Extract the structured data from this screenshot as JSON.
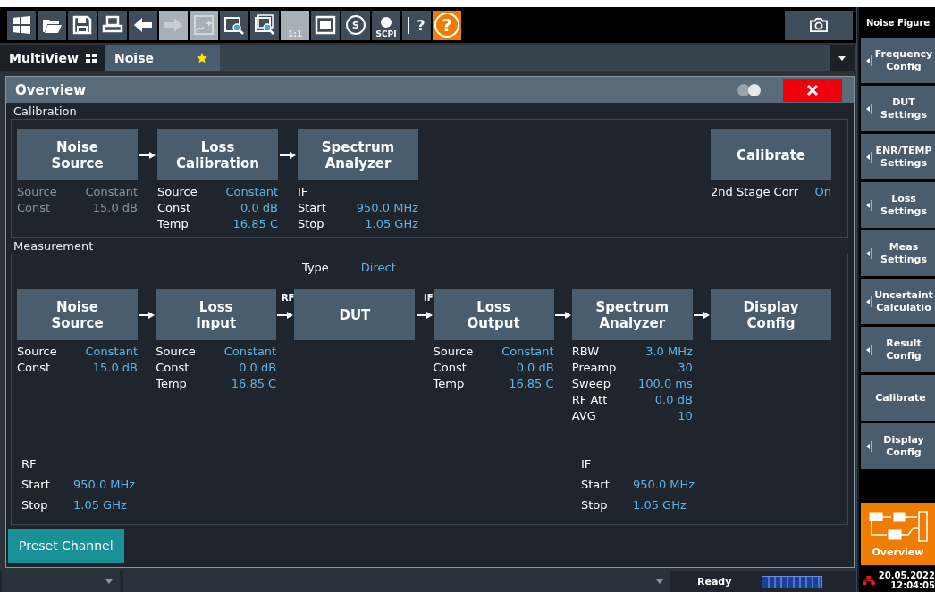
{
  "toolbar": [
    {
      "kind": "windows",
      "disabled": false
    },
    {
      "kind": "open",
      "disabled": false
    },
    {
      "kind": "save",
      "disabled": false
    },
    {
      "kind": "print",
      "disabled": false
    },
    {
      "kind": "undo",
      "disabled": false
    },
    {
      "kind": "redo",
      "disabled": true
    },
    {
      "kind": "marker-zoom",
      "disabled": true
    },
    {
      "kind": "zoom",
      "disabled": false
    },
    {
      "kind": "multi-zoom",
      "disabled": false
    },
    {
      "kind": "zoom-reset",
      "disabled": true,
      "label": "1:1"
    },
    {
      "kind": "fullscreen",
      "disabled": false
    },
    {
      "kind": "sync",
      "disabled": false,
      "label": "S"
    },
    {
      "kind": "scpi",
      "disabled": false,
      "label": "SCPI"
    },
    {
      "kind": "pointer-help",
      "disabled": false,
      "label": "?"
    },
    {
      "kind": "help",
      "disabled": false,
      "label": "?"
    }
  ],
  "tabs": [
    {
      "label": "MultiView",
      "selected": false,
      "kind": "multiview"
    },
    {
      "label": "Noise",
      "selected": true,
      "kind": "channel"
    }
  ],
  "dialog": {
    "title": "Overview",
    "calibration": {
      "title": "Calibration",
      "chain": [
        {
          "title": "Noise\nSource",
          "params_disabled": true,
          "params": [
            {
              "label": "Source",
              "value": "Constant"
            },
            {
              "label": "Const",
              "value": "15.0 dB"
            }
          ]
        },
        {
          "title": "Loss\nCalibration",
          "params_disabled": false,
          "params": [
            {
              "label": "Source",
              "value": "Constant"
            },
            {
              "label": "Const",
              "value": "0.0 dB"
            },
            {
              "label": "Temp",
              "value": "16.85 C"
            }
          ]
        },
        {
          "title": "Spectrum\nAnalyzer",
          "params_disabled": false,
          "params": [
            {
              "label": "IF"
            },
            {
              "label": "Start",
              "value": "950.0 MHz"
            },
            {
              "label": "Stop",
              "value": "1.05 GHz"
            }
          ]
        }
      ],
      "action": {
        "label": "Calibrate",
        "setting": {
          "label": "2nd Stage Corr",
          "value": "On"
        }
      }
    },
    "measurement": {
      "title": "Measurement",
      "type": {
        "label": "Type",
        "value": "Direct"
      },
      "chain": [
        {
          "title": "Noise\nSource",
          "params_disabled": false,
          "params": [
            {
              "label": "Source",
              "value": "Constant"
            },
            {
              "label": "Const",
              "value": "15.0 dB"
            }
          ]
        },
        {
          "title": "Loss\nInput",
          "params_disabled": false,
          "params": [
            {
              "label": "Source",
              "value": "Constant"
            },
            {
              "label": "Const",
              "value": "0.0 dB"
            },
            {
              "label": "Temp",
              "value": "16.85 C"
            }
          ]
        },
        {
          "title": "DUT",
          "in_label": "RF"
        },
        {
          "title": "Loss\nOutput",
          "in_label": "IF",
          "params_disabled": false,
          "params": [
            {
              "label": "Source",
              "value": "Constant"
            },
            {
              "label": "Const",
              "value": "0.0 dB"
            },
            {
              "label": "Temp",
              "value": "16.85 C"
            }
          ]
        },
        {
          "title": "Spectrum\nAnalyzer",
          "params_disabled": false,
          "params": [
            {
              "label": "RBW",
              "value": "3.0 MHz"
            },
            {
              "label": "Preamp",
              "value": "30"
            },
            {
              "label": "Sweep",
              "value": "100.0 ms"
            },
            {
              "label": "RF Att",
              "value": "0.0 dB"
            },
            {
              "label": "AVG",
              "value": "10"
            }
          ]
        },
        {
          "title": "Display\nConfig"
        }
      ],
      "bands": [
        {
          "title": "RF",
          "rows": [
            {
              "label": "Start",
              "value": "950.0 MHz"
            },
            {
              "label": "Stop",
              "value": "1.05 GHz"
            }
          ]
        },
        {
          "title": "IF",
          "rows": [
            {
              "label": "Start",
              "value": "950.0 MHz"
            },
            {
              "label": "Stop",
              "value": "1.05 GHz"
            }
          ]
        }
      ]
    },
    "preset_button": "Preset Channel"
  },
  "softkeys": {
    "title": "Noise Figure",
    "keys": [
      {
        "label": "Frequency\nConfig",
        "submenu": true
      },
      {
        "label": "DUT\nSettings",
        "submenu": true
      },
      {
        "label": "ENR/TEMP\nSettings",
        "submenu": true
      },
      {
        "label": "Loss\nSettings",
        "submenu": true
      },
      {
        "label": "Meas\nSettings",
        "submenu": true
      },
      {
        "label": "Uncertaint\nCalculatio",
        "submenu": true
      },
      {
        "label": "Result\nConfig",
        "submenu": true
      },
      {
        "label": "Calibrate",
        "submenu": false
      },
      {
        "label": "Display\nConfig",
        "submenu": true
      }
    ],
    "overview": {
      "label": "Overview",
      "selected": true
    }
  },
  "status_bar": {
    "state": "Ready",
    "date": "20.05.2022",
    "time": "12:04:05"
  }
}
